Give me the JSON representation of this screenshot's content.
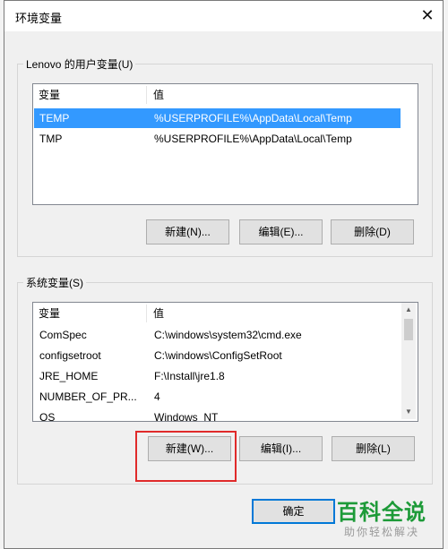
{
  "window": {
    "title": "环境变量",
    "close_glyph": "✕"
  },
  "user_vars": {
    "group_label": "Lenovo 的用户变量(U)",
    "columns": [
      "变量",
      "值"
    ],
    "rows": [
      {
        "name": "TEMP",
        "value": "%USERPROFILE%\\AppData\\Local\\Temp",
        "selected": true
      },
      {
        "name": "TMP",
        "value": "%USERPROFILE%\\AppData\\Local\\Temp",
        "selected": false
      }
    ],
    "buttons": {
      "new": "新建(N)...",
      "edit": "编辑(E)...",
      "delete": "删除(D)"
    }
  },
  "system_vars": {
    "group_label": "系统变量(S)",
    "columns": [
      "变量",
      "值"
    ],
    "rows": [
      {
        "name": "ComSpec",
        "value": "C:\\windows\\system32\\cmd.exe"
      },
      {
        "name": "configsetroot",
        "value": "C:\\windows\\ConfigSetRoot"
      },
      {
        "name": "JRE_HOME",
        "value": "F:\\Install\\jre1.8"
      },
      {
        "name": "NUMBER_OF_PR...",
        "value": "4"
      },
      {
        "name": "OS",
        "value": "Windows_NT"
      }
    ],
    "buttons": {
      "new": "新建(W)...",
      "edit": "编辑(I)...",
      "delete": "删除(L)"
    }
  },
  "footer": {
    "ok": "确定"
  },
  "watermark": {
    "main": "百科全说",
    "sub": "助你轻松解决"
  },
  "colors": {
    "selection": "#3399ff",
    "highlight_box": "#e02a2a",
    "watermark": "#1d9a38",
    "default_button_border": "#0078d7"
  }
}
